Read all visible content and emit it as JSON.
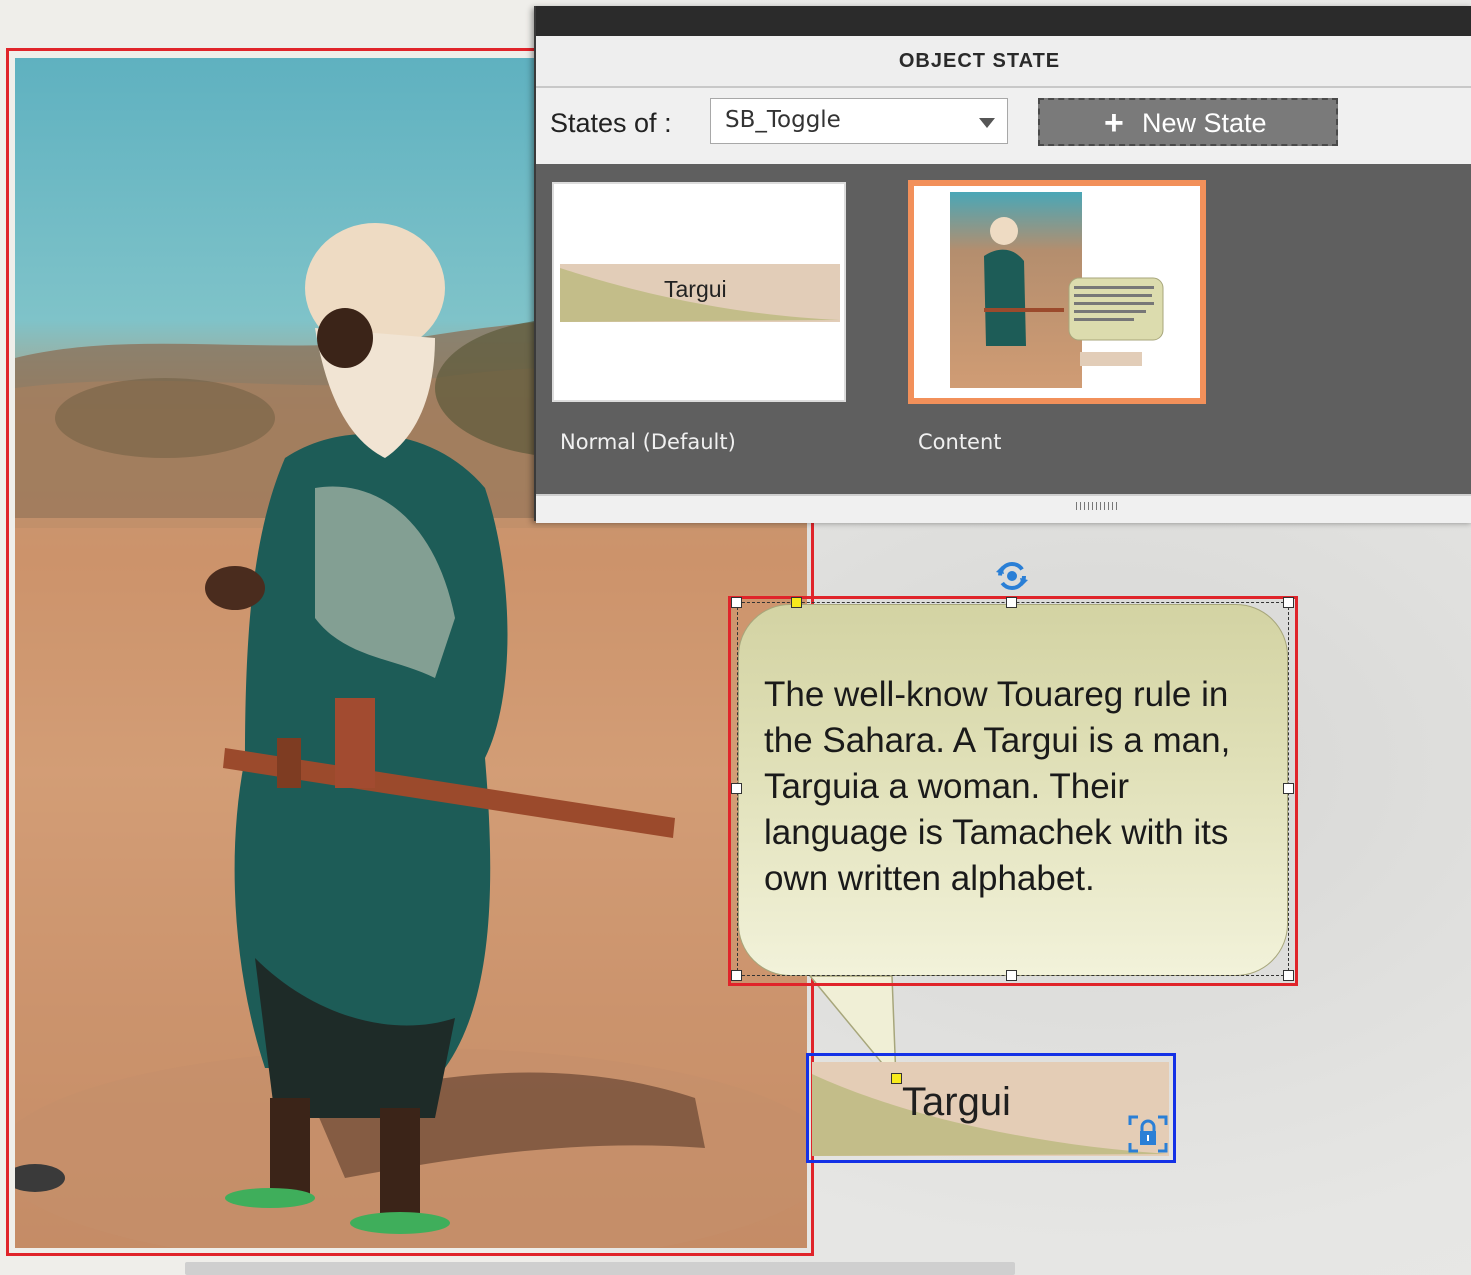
{
  "panel": {
    "title": "OBJECT STATE",
    "states_of_label": "States of :",
    "selected_object": "SB_Toggle",
    "new_state_label": "New State",
    "states": [
      {
        "caption": "Normal (Default)",
        "preview_text": "Targui"
      },
      {
        "caption": "Content"
      }
    ]
  },
  "callout": {
    "text": "The well-know Touareg rule in the Sahara. A Targui is a man, Targuia a woman. Their language is Tamachek with its own written alphabet."
  },
  "banner": {
    "text": "Targui"
  },
  "colors": {
    "selection_red": "#e0242a",
    "selection_blue": "#1431e6",
    "selected_state_border": "#f2905a",
    "callout_fill": "#dcdcae",
    "banner_fill": "#e4cdb6",
    "banner_wave": "#c3bd89"
  },
  "icons": [
    "rotate-icon",
    "lock-icon",
    "dropdown-arrow-icon",
    "plus-icon"
  ]
}
